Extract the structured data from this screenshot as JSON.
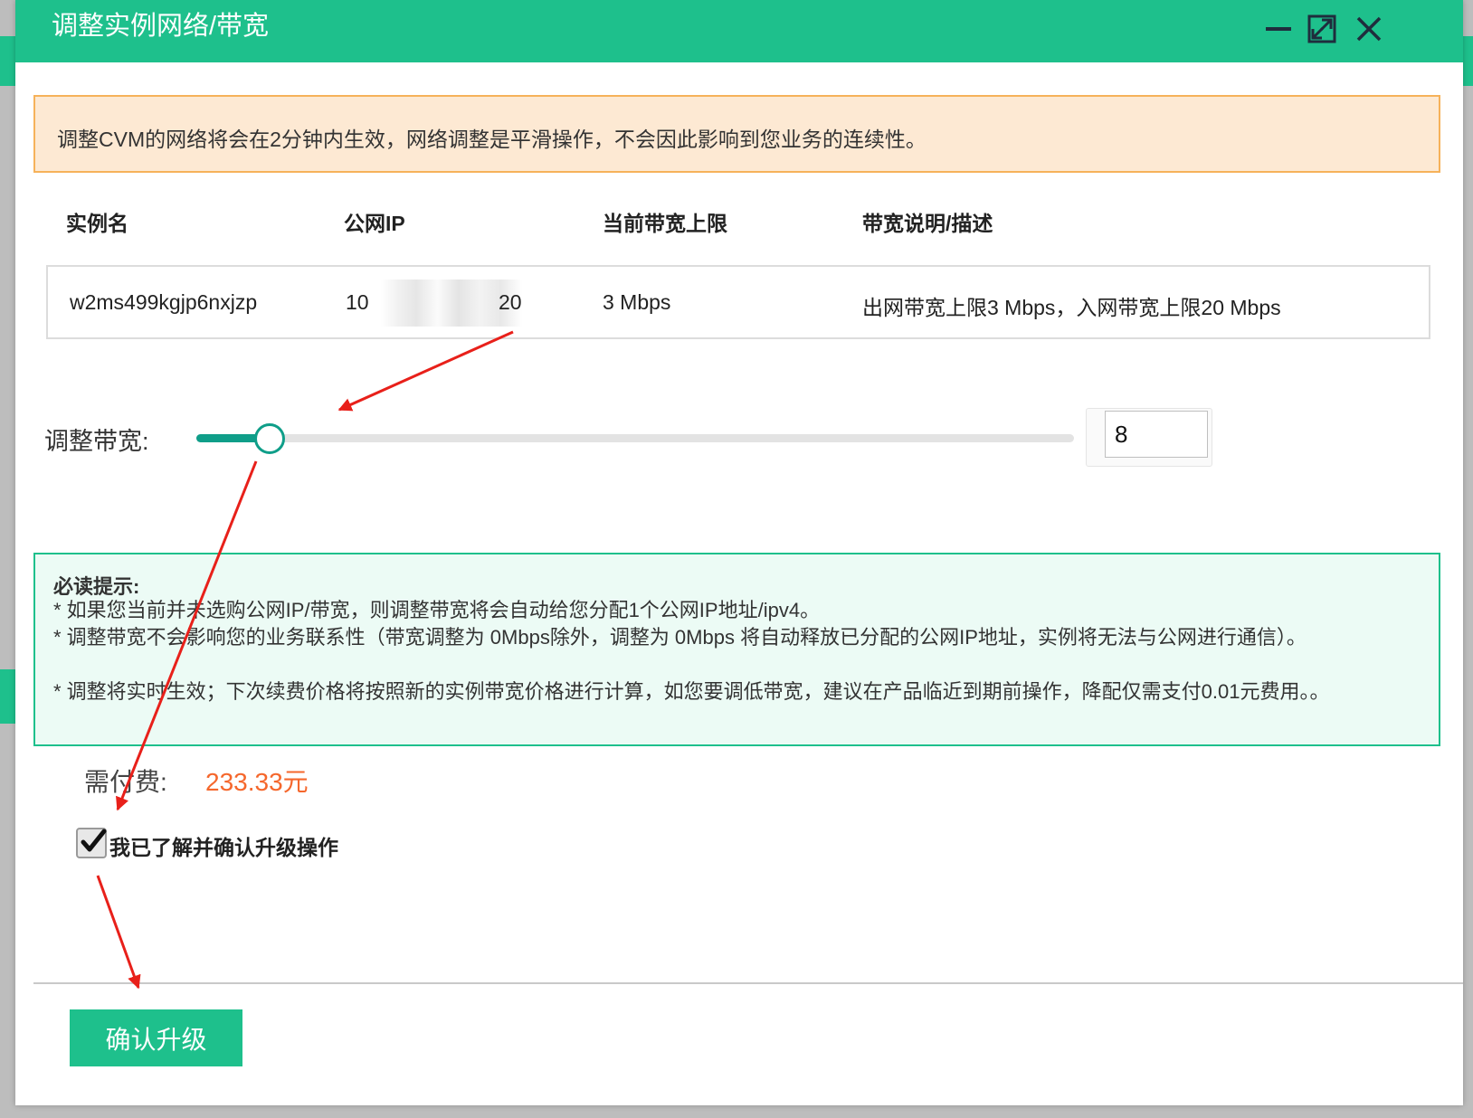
{
  "dialog": {
    "title": "调整实例网络/带宽",
    "notice": "调整CVM的网络将会在2分钟内生效，网络调整是平滑操作，不会因此影响到您业务的连续性。"
  },
  "table": {
    "headers": [
      "实例名",
      "公网IP",
      "当前带宽上限",
      "带宽说明/描述"
    ],
    "row": {
      "instance_name": "w2ms499kgjp6nxjzp",
      "ip_prefix": "10",
      "ip_suffix": "20",
      "bandwidth": "3 Mbps",
      "description": "出网带宽上限3 Mbps，入网带宽上限20 Mbps"
    }
  },
  "bandwidth": {
    "label": "调整带宽:",
    "value": "8",
    "slider_fraction": 0.08
  },
  "tips": {
    "title": "必读提示:",
    "lines": [
      "* 如果您当前并未选购公网IP/带宽，则调整带宽将会自动给您分配1个公网IP地址/ipv4。",
      "* 调整带宽不会影响您的业务联系性（带宽调整为 0Mbps除外，调整为 0Mbps 将自动释放已分配的公网IP地址，实例将无法与公网进行通信）。",
      "* 调整将实时生效；下次续费价格将按照新的实例带宽价格进行计算，如您要调低带宽，建议在产品临近到期前操作，降配仅需支付0.01元费用。。"
    ]
  },
  "payment": {
    "label": "需付费:",
    "amount": "233.33元"
  },
  "confirm_checkbox": {
    "label": "我已了解并确认升级操作",
    "checked": true
  },
  "confirm_button": {
    "label": "确认升级"
  },
  "colors": {
    "brand_green": "#1ec08c",
    "slider_teal": "#0f9e89",
    "price_orange": "#f5672c",
    "notice_border": "#f6b25a",
    "annotation_red": "#e8201a"
  }
}
